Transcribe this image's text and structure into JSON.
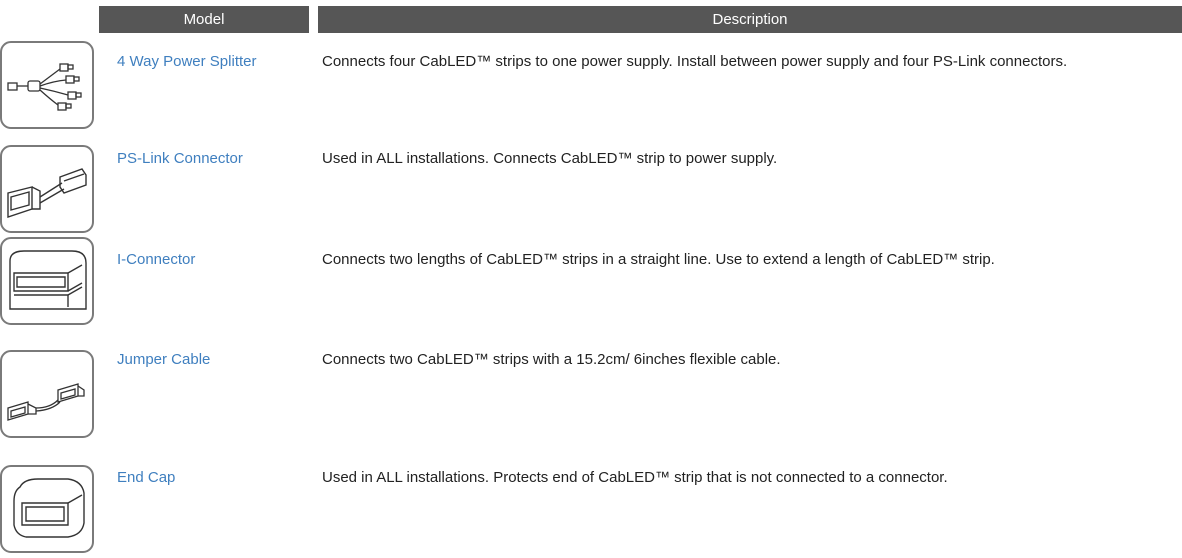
{
  "header": {
    "model_label": "Model",
    "description_label": "Description"
  },
  "colors": {
    "header_bg": "#565656",
    "model_text": "#3f7fbf",
    "thumb_border": "#7a7a7a"
  },
  "rows": [
    {
      "model": "4 Way Power Splitter",
      "description": "Connects four CabLED™ strips to one power supply. Install between power supply and four PS-Link connectors.",
      "icon": "power-splitter-icon"
    },
    {
      "model": "PS-Link Connector",
      "description": "Used in ALL installations. Connects CabLED™ strip to power supply.",
      "icon": "ps-link-connector-icon"
    },
    {
      "model": "I-Connector",
      "description": "Connects two lengths of CabLED™ strips in a straight line. Use to extend a length of CabLED™ strip.",
      "icon": "i-connector-icon"
    },
    {
      "model": "Jumper Cable",
      "description": "Connects two CabLED™ strips with a 15.2cm/ 6inches flexible cable.",
      "icon": "jumper-cable-icon"
    },
    {
      "model": "End Cap",
      "description": "Used in ALL installations. Protects end of CabLED™ strip that is not connected to a connector.",
      "icon": "end-cap-icon"
    }
  ]
}
